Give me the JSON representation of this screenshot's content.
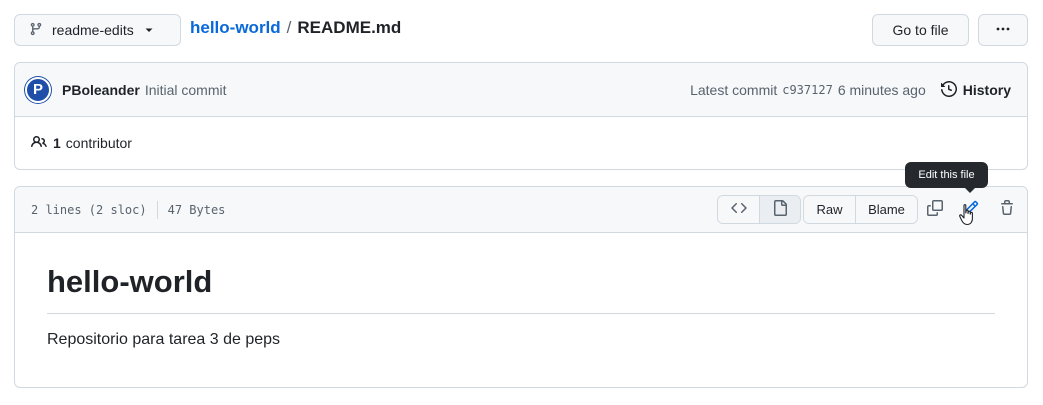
{
  "header": {
    "branch_icon": "git-branch-icon",
    "branch": "readme-edits",
    "repo": "hello-world",
    "separator": "/",
    "file": "README.md",
    "goto_file": "Go to file",
    "more_icon": "kebab-horizontal-icon"
  },
  "commit": {
    "avatar_letter": "P",
    "author": "PBoleander",
    "message": "Initial commit",
    "latest_label": "Latest commit",
    "sha": "c937127",
    "time": "6 minutes ago",
    "history_icon": "history-icon",
    "history_label": "History"
  },
  "contributors": {
    "icon": "people-icon",
    "count": "1",
    "label": "contributor"
  },
  "file": {
    "lines": "2 lines (2 sloc)",
    "size": "47 Bytes",
    "code_icon": "code-icon",
    "preview_icon": "file-icon",
    "raw_label": "Raw",
    "blame_label": "Blame",
    "copy_icon": "copy-icon",
    "edit_icon": "pencil-icon",
    "delete_icon": "trash-icon",
    "tooltip": "Edit this file"
  },
  "readme": {
    "heading": "hello-world",
    "body": "Repositorio para tarea 3 de peps"
  },
  "colors": {
    "link": "#0969da",
    "border": "#d1d9e0",
    "header_bg": "#f6f8fa",
    "tooltip_bg": "#25292e"
  }
}
